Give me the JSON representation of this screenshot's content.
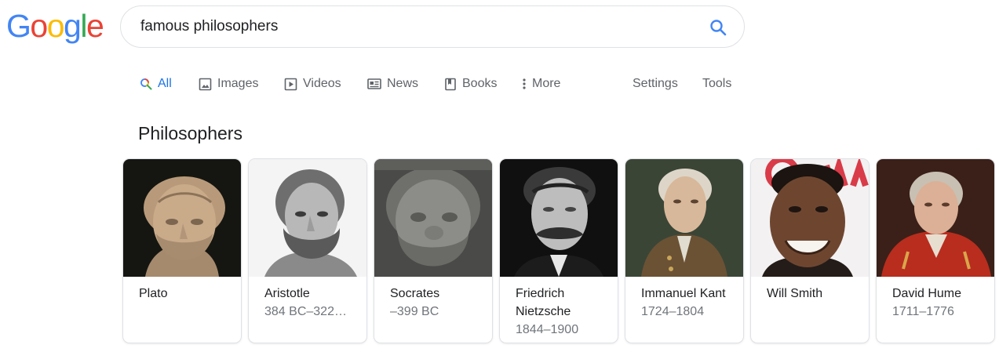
{
  "logo": {
    "letters": [
      "G",
      "o",
      "o",
      "g",
      "l",
      "e"
    ],
    "colors": [
      "#4285F4",
      "#EA4335",
      "#FBBC05",
      "#4285F4",
      "#34A853",
      "#EA4335"
    ]
  },
  "search": {
    "query": "famous philosophers",
    "icon": "search-icon"
  },
  "tabs": [
    {
      "label": "All",
      "icon": "search-icon",
      "active": true
    },
    {
      "label": "Images",
      "icon": "image-icon",
      "active": false
    },
    {
      "label": "Videos",
      "icon": "play-icon",
      "active": false
    },
    {
      "label": "News",
      "icon": "news-icon",
      "active": false
    },
    {
      "label": "Books",
      "icon": "book-icon",
      "active": false
    },
    {
      "label": "More",
      "icon": "more-vertical-icon",
      "active": false
    }
  ],
  "tools": {
    "settings": "Settings",
    "tools": "Tools"
  },
  "section_title": "Philosophers",
  "philosophers": [
    {
      "name": "Plato",
      "dates": ""
    },
    {
      "name": "Aristotle",
      "dates": "384 BC–322…"
    },
    {
      "name": "Socrates",
      "dates": "–399 BC"
    },
    {
      "name": "Friedrich Nietzsche",
      "dates": "1844–1900"
    },
    {
      "name": "Immanuel Kant",
      "dates": "1724–1804"
    },
    {
      "name": "Will Smith",
      "dates": ""
    },
    {
      "name": "David Hume",
      "dates": "1711–1776"
    }
  ],
  "colors": {
    "accent": "#1a73e8",
    "muted": "#70757a",
    "tab_text": "#5f6368",
    "border": "#dfe1e5"
  }
}
